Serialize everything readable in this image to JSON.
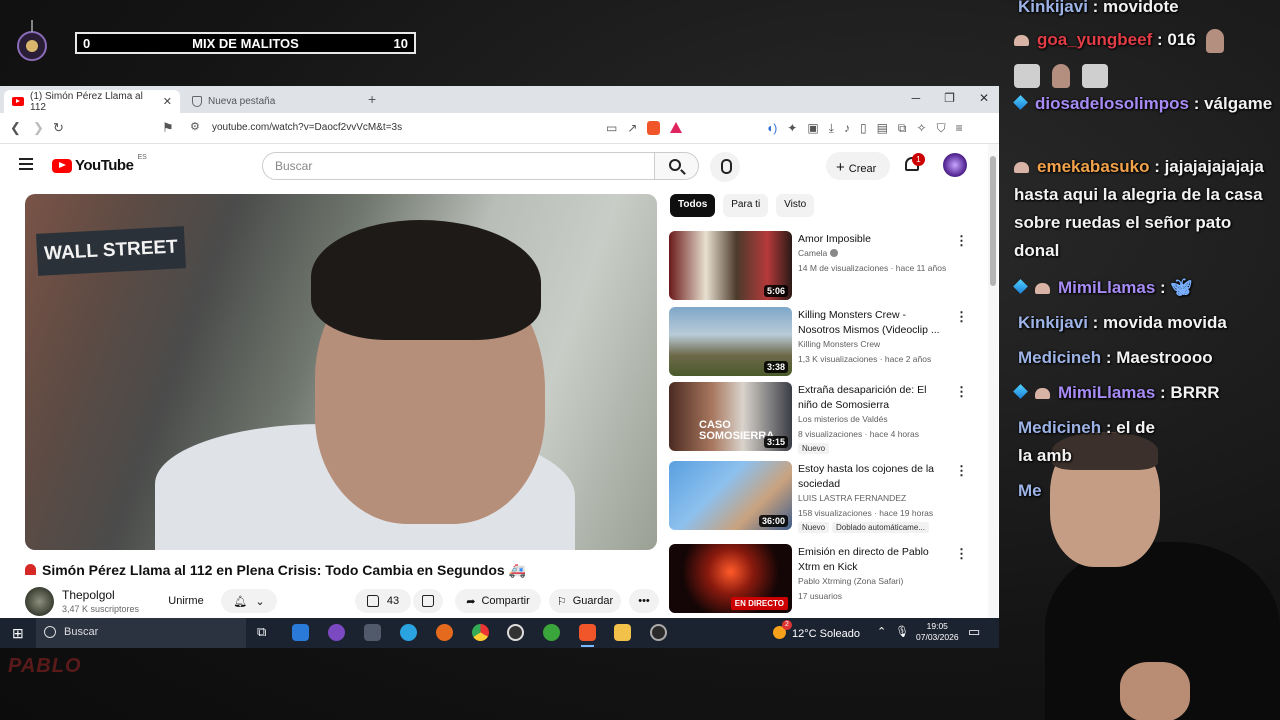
{
  "overlay": {
    "counter_left": "0",
    "counter_title": "MIX DE MALITOS",
    "counter_right": "10"
  },
  "browser": {
    "tabs": [
      {
        "label": "(1) Simón Pérez Llama al 112",
        "active": true
      },
      {
        "label": "Nueva pestaña",
        "active": false
      }
    ],
    "url": "youtube.com/watch?v=Daocf2vvVcM&t=3s"
  },
  "youtube": {
    "logo_text": "YouTube",
    "region": "ES",
    "search_placeholder": "Buscar",
    "create_label": "Crear",
    "notif_count": "1",
    "video": {
      "sign_text": "WALL STREET",
      "title": "Simón Pérez Llama al 112 en Plena Crisis: Todo Cambia en Segundos",
      "channel": "Thepolgol",
      "subscribers": "3,47 K suscriptores",
      "join_label": "Unirme",
      "likes": "43",
      "share_label": "Compartir",
      "save_label": "Guardar"
    },
    "chips": [
      "Todos",
      "Para ti",
      "Visto"
    ],
    "recommendations": [
      {
        "title": "Amor Imposible",
        "channel": "Camela",
        "meta": "14 M de visualizaciones · hace 11 años",
        "duration": "5:06",
        "badge": "",
        "badge2": ""
      },
      {
        "title": "Killing Monsters Crew - Nosotros Mismos (Videoclip ...",
        "channel": "Killing Monsters Crew",
        "meta": "1,3 K visualizaciones · hace 2 años",
        "duration": "3:38",
        "badge": "",
        "badge2": ""
      },
      {
        "title": "Extraña desaparición de: El niño de Somosierra",
        "channel": "Los misterios de Valdés",
        "meta": "8 visualizaciones · hace 4 horas",
        "duration": "3:15",
        "badge": "Nuevo",
        "badge2": "",
        "thumb_text": "CASO SOMOSIERRA"
      },
      {
        "title": "Estoy hasta los cojones de la sociedad",
        "channel": "LUIS LASTRA FERNANDEZ",
        "meta": "158 visualizaciones · hace 19 horas",
        "duration": "36:00",
        "badge": "Nuevo",
        "badge2": "Doblado automáticame..."
      },
      {
        "title": "Emisión en directo de Pablo Xtrm en Kick",
        "channel": "Pablo Xtrming (Zona Safari)",
        "meta": "17 usuarios",
        "duration": "EN DIRECTO",
        "badge": "",
        "badge2": ""
      }
    ]
  },
  "taskbar": {
    "search_label": "Buscar",
    "weather_badge": "2",
    "weather": "12°C  Soleado",
    "time": "19:05",
    "date": "07/03/2026"
  },
  "chat": [
    {
      "user": "Kinkijavi",
      "text": ": movidote",
      "color": "#9db3e6"
    },
    {
      "user": "goa_yungbeef",
      "text": ": 016",
      "color": "#e03d46"
    },
    {
      "user": "diosadelosolimpos",
      "text": ": válgame",
      "color": "#a78bf5"
    },
    {
      "user": "emekabasuko",
      "text": ": jajajajajajaja hasta aqui la alegria de la casa sobre ruedas el señor pato donal",
      "color": "#f2a24a"
    },
    {
      "user": "MimiLlamas",
      "text": ":",
      "color": "#a78bf5"
    },
    {
      "user": "Kinkijavi",
      "text": ": movida movida",
      "color": "#9db3e6"
    },
    {
      "user": "Medicineh",
      "text": ": Maestroooo",
      "color": "#9db3e6"
    },
    {
      "user": "MimiLlamas",
      "text": ": BRRR",
      "color": "#a78bf5"
    },
    {
      "user": "Medicineh",
      "text": ": el de la amb",
      "color": "#9db3e6"
    },
    {
      "user": "Me",
      "text": "",
      "color": "#9db3e6"
    }
  ],
  "watermark": "PABLO"
}
